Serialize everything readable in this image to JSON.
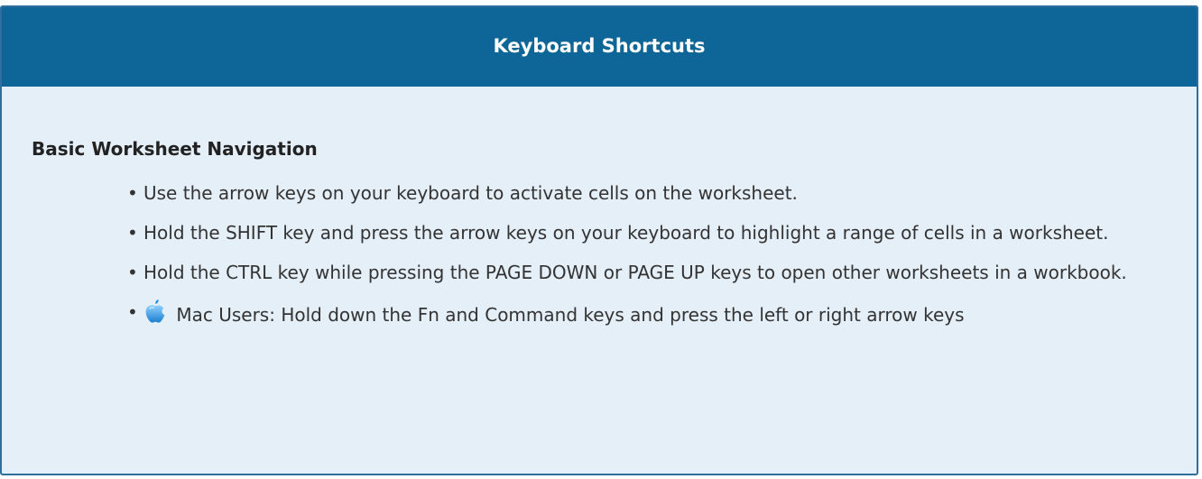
{
  "panel": {
    "title": "Keyboard Shortcuts",
    "section_title": "Basic Worksheet Navigation",
    "items": [
      {
        "text": "Use the arrow keys on your keyboard to activate cells on the worksheet."
      },
      {
        "text": "Hold the SHIFT key and press the arrow keys on your keyboard to highlight a range of cells in a worksheet."
      },
      {
        "text": "Hold the CTRL key while pressing the PAGE DOWN or PAGE UP keys to open other worksheets in a workbook."
      },
      {
        "text": "Mac Users: Hold down the Fn and Command keys and press the left or right arrow keys",
        "icon": "apple-icon"
      }
    ]
  },
  "colors": {
    "header_bg": "#0e6597",
    "panel_bg": "#e4eff8",
    "border": "#2f6f9f"
  }
}
